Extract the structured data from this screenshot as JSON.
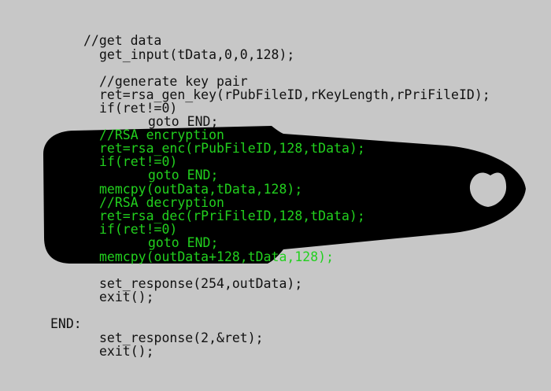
{
  "colors": {
    "background": "#c7c7c7",
    "dongle": "#000000",
    "code_text": "#111111",
    "highlight_text": "#22d01e"
  },
  "illustration": {
    "shape_icon": "usb-dongle-silhouette-with-heart-keyring-hole"
  },
  "code": {
    "lines": [
      "//get data",
      "get_input(tData,0,0,128);",
      "//generate key pair",
      "ret=rsa_gen_key(rPubFileID,rKeyLength,rPriFileID);",
      "if(ret!=0)",
      "goto END;",
      "//RSA encryption",
      "ret=rsa_enc(rPubFileID,128,tData);",
      "if(ret!=0)",
      "goto END;",
      "memcpy(outData,tData,128);",
      "//RSA decryption",
      "ret=rsa_dec(rPriFileID,128,tData);",
      "if(ret!=0)",
      "goto END;",
      "memcpy(outData+128,tData,128);",
      "set_response(254,outData);",
      "exit();",
      "END:",
      "set_response(2,&ret);",
      "exit();"
    ]
  }
}
